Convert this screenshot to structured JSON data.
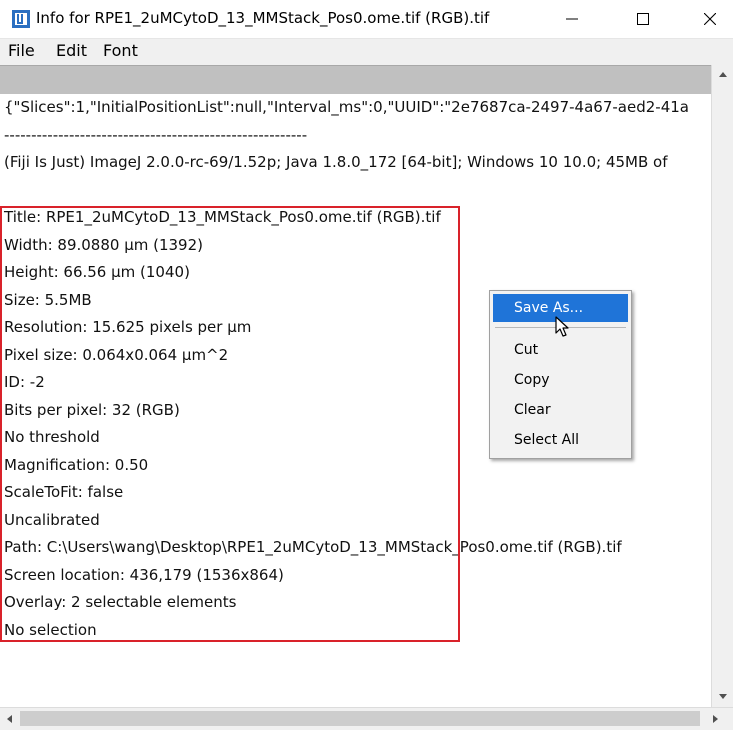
{
  "window": {
    "title": "Info for RPE1_2uMCytoD_13_MMStack_Pos0.ome.tif (RGB).tif"
  },
  "menu": [
    "File",
    "Edit",
    "Font"
  ],
  "content": {
    "lines": [
      "{\"Slices\":1,\"InitialPositionList\":null,\"Interval_ms\":0,\"UUID\":\"2e7687ca-2497-4a67-aed2-41a",
      "--------------------------------------------------------",
      "(Fiji Is Just) ImageJ 2.0.0-rc-69/1.52p; Java 1.8.0_172 [64-bit]; Windows 10 10.0; 45MB of",
      "",
      "Title: RPE1_2uMCytoD_13_MMStack_Pos0.ome.tif (RGB).tif",
      "Width:  89.0880 µm (1392)",
      "Height:  66.56 µm (1040)",
      "Size:  5.5MB",
      "Resolution:  15.625 pixels per µm",
      "Pixel size: 0.064x0.064 µm^2",
      "ID: -2",
      "Bits per pixel: 32 (RGB)",
      "No threshold",
      "Magnification: 0.50",
      "ScaleToFit: false",
      "Uncalibrated",
      "Path: C:\\Users\\wang\\Desktop\\RPE1_2uMCytoD_13_MMStack_Pos0.ome.tif (RGB).tif",
      "Screen location: 436,179 (1536x864)",
      "Overlay: 2 selectable  elements",
      "No selection"
    ]
  },
  "context_menu": {
    "items": [
      "Save As...",
      "Cut",
      "Copy",
      "Clear",
      "Select All"
    ],
    "selected": "Save As..."
  },
  "colors": {
    "highlight_border": "#d9222a",
    "menu_selection": "#1f74d8"
  }
}
